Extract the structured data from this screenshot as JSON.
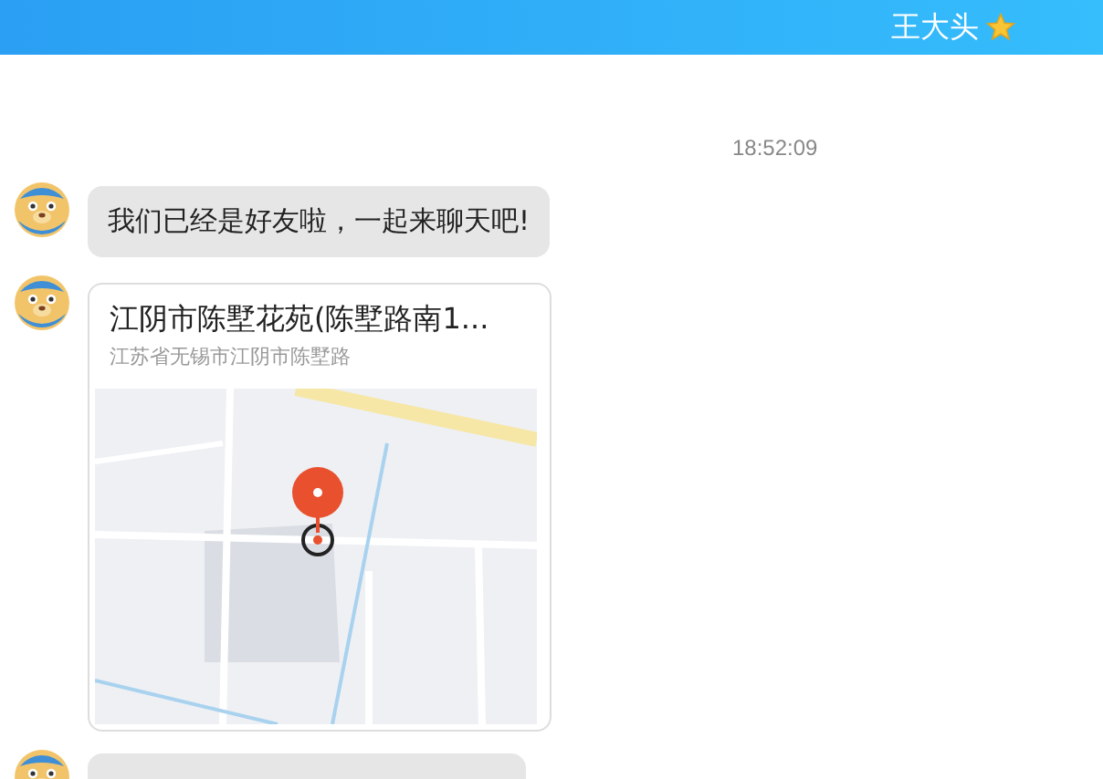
{
  "header": {
    "title": "王大头"
  },
  "messages": [
    {
      "kind": "time",
      "text": "18:52:09"
    },
    {
      "kind": "text",
      "text": "我们已经是好友啦，一起来聊天吧!"
    },
    {
      "kind": "location",
      "title": "江阴市陈墅花苑(陈墅路南1...",
      "address": "江苏省无锡市江阴市陈墅路"
    },
    {
      "kind": "partial"
    }
  ]
}
